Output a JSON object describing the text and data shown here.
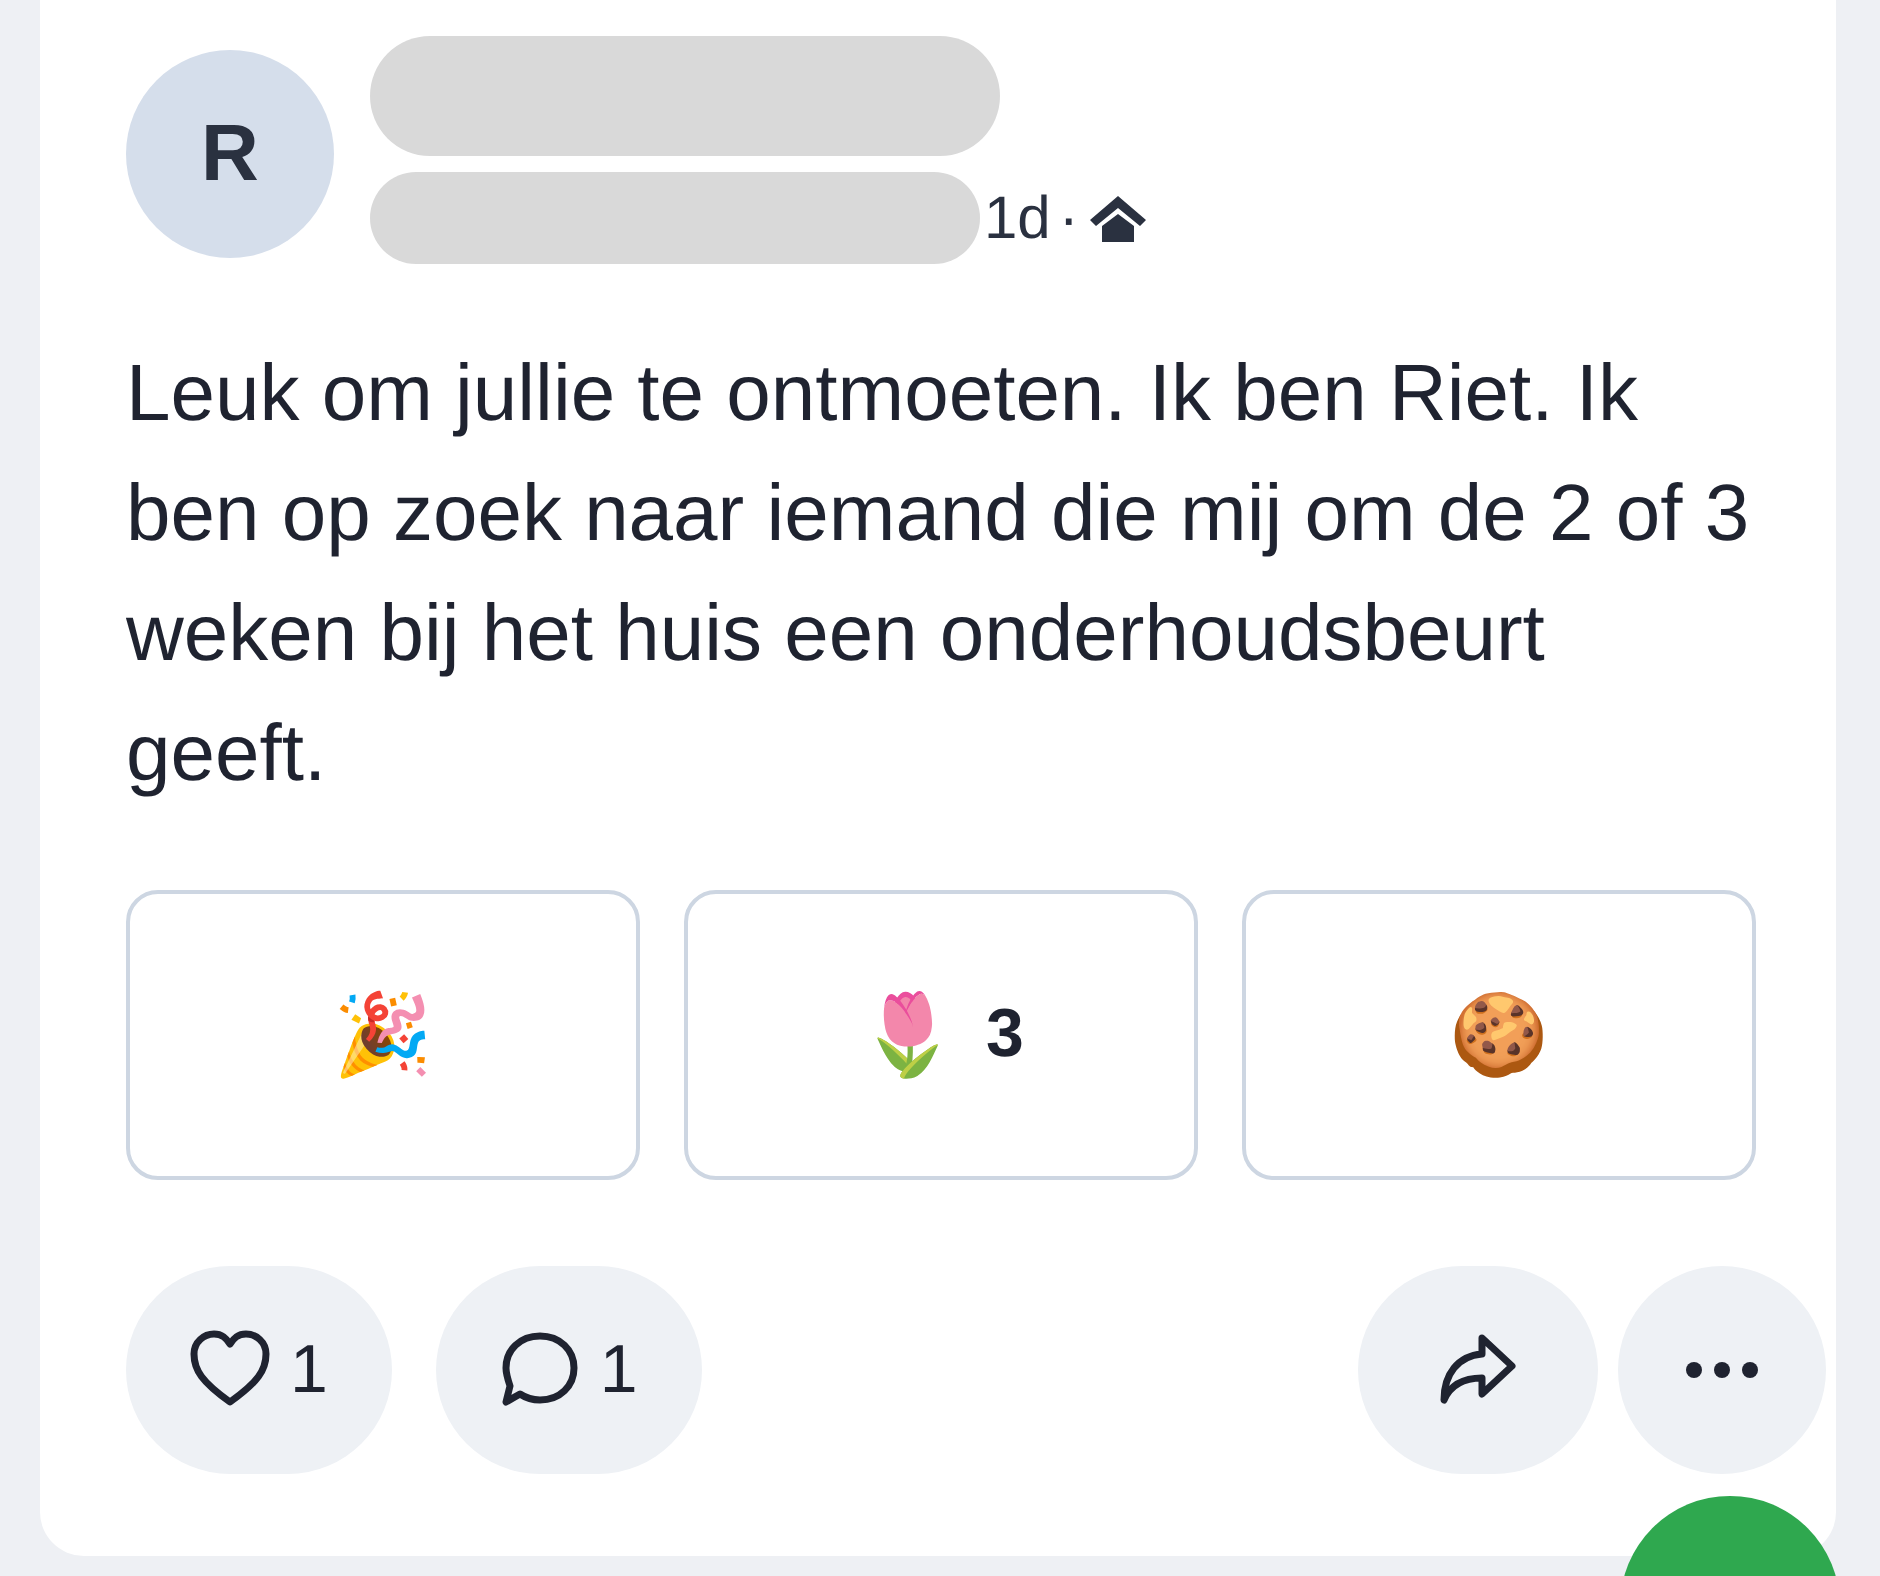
{
  "post": {
    "avatar_initial": "R",
    "time": "1d",
    "separator": "·",
    "body": "Leuk om jullie te ontmoeten. Ik ben Riet. Ik ben op zoek naar iemand die mij om de 2 of 3 weken bij het huis een onderhoudsbeurt geeft.",
    "reactions": [
      {
        "emoji": "🎉"
      },
      {
        "emoji": "🌷",
        "count": "3"
      },
      {
        "emoji": "🍪"
      }
    ],
    "actions": [
      {
        "kind": "like",
        "count": "1"
      },
      {
        "kind": "comment",
        "count": "1"
      },
      {
        "kind": "share"
      },
      {
        "kind": "more"
      }
    ]
  }
}
